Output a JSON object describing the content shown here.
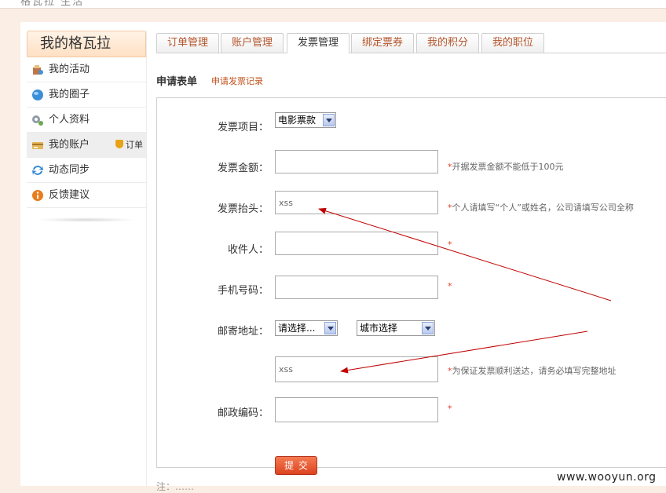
{
  "page": {
    "top_text": "格瓦拉 生活"
  },
  "sidebar": {
    "title": "我的格瓦拉",
    "items": [
      {
        "label": "我的活动",
        "icon": "activity-icon"
      },
      {
        "label": "我的圈子",
        "icon": "circle-icon"
      },
      {
        "label": "个人资料",
        "icon": "profile-icon"
      },
      {
        "label": "我的账户",
        "icon": "account-icon",
        "extra": "订单",
        "active": true
      },
      {
        "label": "动态同步",
        "icon": "sync-icon"
      },
      {
        "label": "反馈建议",
        "icon": "info-icon"
      }
    ]
  },
  "tabs": [
    {
      "label": "订单管理"
    },
    {
      "label": "账户管理"
    },
    {
      "label": "发票管理",
      "active": true
    },
    {
      "label": "绑定票券"
    },
    {
      "label": "我的积分"
    },
    {
      "label": "我的职位"
    }
  ],
  "form": {
    "title": "申请表单",
    "sublink": "申请发票记录",
    "item_label": "发票项目：",
    "item_value": "电影票款",
    "amount_label": "发票金额：",
    "amount_value": "",
    "amount_hint": "开据发票金额不能低于100元",
    "header_label": "发票抬头：",
    "header_value": "xss",
    "header_hint": "个人请填写“个人”或姓名，公司请填写公司全称",
    "receiver_label": "收件人：",
    "receiver_value": "",
    "phone_label": "手机号码：",
    "phone_value": "",
    "address_label": "邮寄地址：",
    "province_value": "请选择...",
    "city_value": "城市选择",
    "address_value": "xss",
    "address_hint": "为保证发票顺利送达，请务必填写完整地址",
    "zip_label": "邮政编码：",
    "zip_value": "",
    "required_mark": "*",
    "submit_label": "提交"
  },
  "bottom_text": "注：……",
  "watermark": "www.wooyun.org",
  "colors": {
    "accent": "#c0501c",
    "required": "#e0412b",
    "arrow": "#c00000"
  }
}
